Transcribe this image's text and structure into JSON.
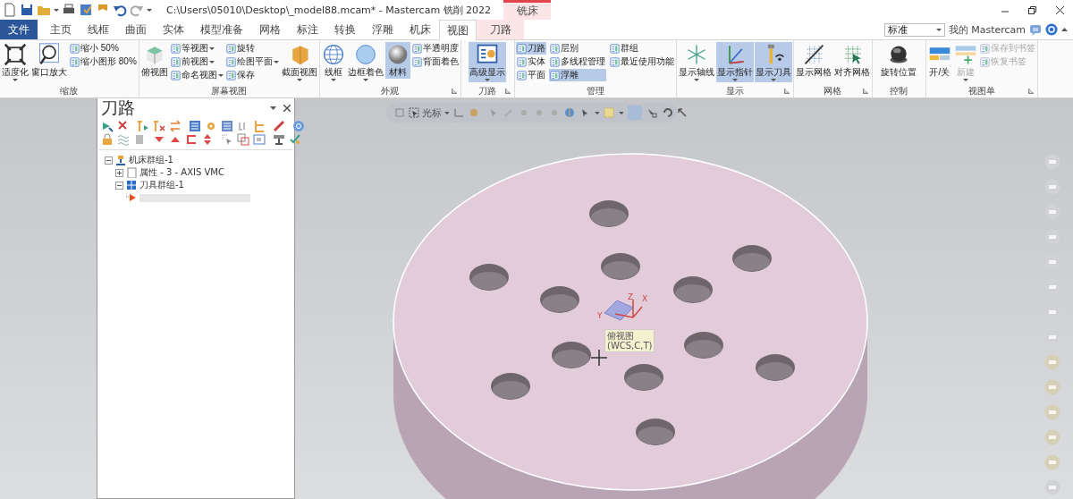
{
  "title_bar": {
    "title": "C:\\Users\\05010\\Desktop\\_model88.mcam* - Mastercam 铣削 2022",
    "context_group": "铣床"
  },
  "tabs": [
    {
      "label": "文件",
      "kind": "file",
      "selected": false
    },
    {
      "label": "主页",
      "kind": "normal",
      "selected": false
    },
    {
      "label": "线框",
      "kind": "normal",
      "selected": false
    },
    {
      "label": "曲面",
      "kind": "normal",
      "selected": false
    },
    {
      "label": "实体",
      "kind": "normal",
      "selected": false
    },
    {
      "label": "模型准备",
      "kind": "normal",
      "selected": false
    },
    {
      "label": "网格",
      "kind": "normal",
      "selected": false
    },
    {
      "label": "标注",
      "kind": "normal",
      "selected": false
    },
    {
      "label": "转换",
      "kind": "normal",
      "selected": false
    },
    {
      "label": "浮雕",
      "kind": "normal",
      "selected": false
    },
    {
      "label": "机床",
      "kind": "normal",
      "selected": false
    },
    {
      "label": "视图",
      "kind": "normal",
      "selected": true
    },
    {
      "label": "刀路",
      "kind": "context",
      "selected": false
    }
  ],
  "ribbon_right": {
    "dropdown_value": "标准",
    "account": "我的 Mastercam"
  },
  "ribbon_groups": [
    {
      "label": "缩放",
      "launcher": false,
      "items": [
        {
          "kind": "large",
          "label": "适度化",
          "dropdown": true,
          "selected": false,
          "disabled": false
        },
        {
          "kind": "large",
          "label": "窗口放大",
          "dropdown": false,
          "selected": false,
          "disabled": false
        },
        {
          "kind": "column",
          "items": [
            {
              "label": "缩小 50%",
              "dropdown": false,
              "selected": false,
              "disabled": false
            },
            {
              "label": "缩小图形 80%",
              "dropdown": false,
              "selected": false,
              "disabled": false
            }
          ]
        }
      ]
    },
    {
      "label": "屏幕视图",
      "launcher": false,
      "items": [
        {
          "kind": "large",
          "label": "俯视图",
          "dropdown": false,
          "selected": false,
          "disabled": false
        },
        {
          "kind": "column",
          "items": [
            {
              "label": "等视图",
              "dropdown": true,
              "selected": false,
              "disabled": false
            },
            {
              "label": "前视图",
              "dropdown": true,
              "selected": false,
              "disabled": false
            },
            {
              "label": "命名视图",
              "dropdown": true,
              "selected": false,
              "disabled": false
            }
          ]
        },
        {
          "kind": "column",
          "items": [
            {
              "label": "旋转",
              "dropdown": false,
              "selected": false,
              "disabled": false
            },
            {
              "label": "绘图平面",
              "dropdown": true,
              "selected": false,
              "disabled": false
            },
            {
              "label": "保存",
              "dropdown": false,
              "selected": false,
              "disabled": false
            }
          ]
        },
        {
          "kind": "large",
          "label": "截面视图",
          "dropdown": true,
          "selected": false,
          "disabled": false
        }
      ]
    },
    {
      "label": "外观",
      "launcher": true,
      "items": [
        {
          "kind": "large",
          "label": "线框",
          "dropdown": true,
          "selected": false,
          "disabled": false
        },
        {
          "kind": "large",
          "label": "边框着色",
          "dropdown": true,
          "selected": false,
          "disabled": false
        },
        {
          "kind": "large",
          "label": "材料",
          "dropdown": false,
          "selected": true,
          "disabled": false
        },
        {
          "kind": "column",
          "items": [
            {
              "label": "半透明度",
              "dropdown": false,
              "selected": false,
              "disabled": false
            },
            {
              "label": "背面着色",
              "dropdown": false,
              "selected": false,
              "disabled": false
            }
          ]
        }
      ]
    },
    {
      "label": "刀路",
      "launcher": true,
      "items": [
        {
          "kind": "large",
          "label": "高级显示",
          "dropdown": true,
          "selected": true,
          "disabled": false
        }
      ]
    },
    {
      "label": "管理",
      "launcher": false,
      "items": [
        {
          "kind": "column",
          "items": [
            {
              "label": "刀路",
              "dropdown": false,
              "selected": true,
              "disabled": false
            },
            {
              "label": "实体",
              "dropdown": false,
              "selected": false,
              "disabled": false
            },
            {
              "label": "平面",
              "dropdown": false,
              "selected": false,
              "disabled": false
            }
          ]
        },
        {
          "kind": "column",
          "items": [
            {
              "label": "层别",
              "dropdown": false,
              "selected": false,
              "disabled": false
            },
            {
              "label": "多线程管理",
              "dropdown": false,
              "selected": false,
              "disabled": false
            },
            {
              "label": "浮雕",
              "dropdown": false,
              "selected": true,
              "disabled": false
            }
          ]
        },
        {
          "kind": "column",
          "items": [
            {
              "label": "群组",
              "dropdown": false,
              "selected": false,
              "disabled": false
            },
            {
              "label": "最近使用功能",
              "dropdown": false,
              "selected": false,
              "disabled": false
            }
          ]
        }
      ]
    },
    {
      "label": "显示",
      "launcher": true,
      "items": [
        {
          "kind": "large",
          "label": "显示轴线",
          "dropdown": true,
          "selected": false,
          "disabled": false
        },
        {
          "kind": "large",
          "label": "显示指针",
          "dropdown": true,
          "selected": true,
          "disabled": false
        },
        {
          "kind": "large",
          "label": "显示刀具",
          "dropdown": true,
          "selected": true,
          "disabled": false
        }
      ]
    },
    {
      "label": "网格",
      "launcher": true,
      "items": [
        {
          "kind": "large",
          "label": "显示网格",
          "dropdown": false,
          "selected": false,
          "disabled": false
        },
        {
          "kind": "large",
          "label": "对齐网格",
          "dropdown": false,
          "selected": false,
          "disabled": false
        }
      ]
    },
    {
      "label": "控制",
      "launcher": false,
      "items": [
        {
          "kind": "large",
          "label": "旋转位置",
          "dropdown": false,
          "selected": false,
          "disabled": false
        }
      ]
    },
    {
      "label": "视图单",
      "launcher": true,
      "items": [
        {
          "kind": "large",
          "label": "开/关",
          "dropdown": false,
          "selected": false,
          "disabled": false
        },
        {
          "kind": "large",
          "label": "新建",
          "dropdown": true,
          "selected": false,
          "disabled": true
        },
        {
          "kind": "column",
          "items": [
            {
              "label": "保存到书签",
              "dropdown": false,
              "selected": false,
              "disabled": true
            },
            {
              "label": "恢复书签",
              "dropdown": false,
              "selected": false,
              "disabled": true
            }
          ]
        }
      ]
    }
  ],
  "view_toolbar": {
    "label": "光标"
  },
  "toolpath_panel": {
    "title": "刀路",
    "tree": [
      {
        "label": "机床群组-1",
        "kind": "machine",
        "expanded": true,
        "children": [
          {
            "label": "属性 - 3 - AXIS VMC",
            "kind": "properties",
            "expanded": false
          },
          {
            "label": "刀具群组-1",
            "kind": "toolgroup",
            "expanded": true,
            "children": [
              {
                "kind": "insert"
              }
            ]
          }
        ]
      }
    ]
  },
  "gnomon": {
    "axes": [
      "X",
      "Y",
      "Z"
    ]
  },
  "view_label": {
    "name": "俯视图",
    "detail": "(WCS,C,T)"
  }
}
